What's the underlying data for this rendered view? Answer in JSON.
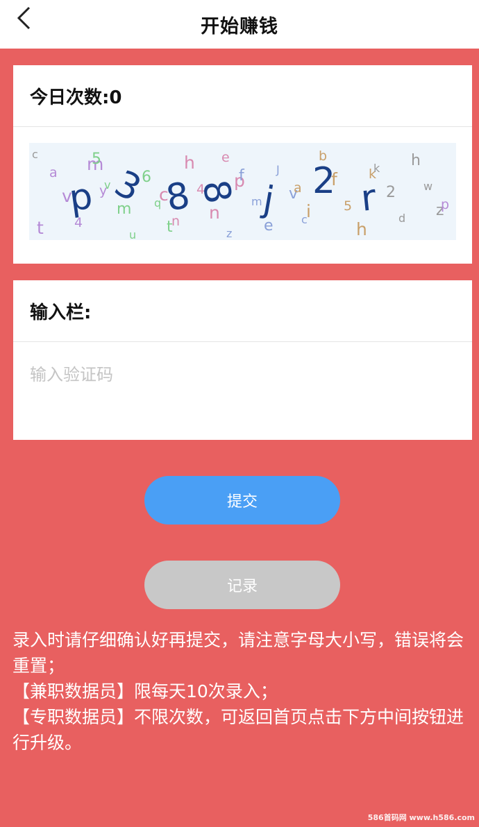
{
  "header": {
    "title": "开始赚钱",
    "back_icon": "chevron-left-icon"
  },
  "count_card": {
    "label": "今日次数:0"
  },
  "captcha": {
    "code_chars": [
      "p",
      "3",
      "8",
      "8",
      "j",
      "2",
      "r"
    ],
    "noise_chars": [
      "c",
      "y",
      "t",
      "p",
      "c",
      "k",
      "z",
      "m",
      "q",
      "e",
      "v",
      "h",
      "w",
      "4",
      "6",
      "n",
      "J",
      "5",
      "h",
      "v",
      "u",
      "4",
      "e",
      "f",
      "d",
      "a",
      "m",
      "h",
      "m",
      "b",
      "2",
      "t",
      "v",
      "n",
      "f",
      "i",
      "k",
      "p",
      "5",
      "c",
      "z",
      "a"
    ],
    "code_color": "#1a3f86"
  },
  "input_card": {
    "label": "输入栏:",
    "placeholder": "输入验证码",
    "value": ""
  },
  "buttons": {
    "submit_label": "提交",
    "record_label": "记录"
  },
  "notice": {
    "line1": "录入时请仔细确认好再提交，请注意字母大小写，错误将会重置；",
    "line2": "【兼职数据员】限每天10次录入；",
    "line3": "【专职数据员】不限次数，可返回首页点击下方中间按钮进行升级。"
  },
  "watermark": "586首码网 www.h586.com",
  "colors": {
    "background": "#e86060",
    "submit": "#4a9ff5",
    "record": "#c8c8c8"
  }
}
